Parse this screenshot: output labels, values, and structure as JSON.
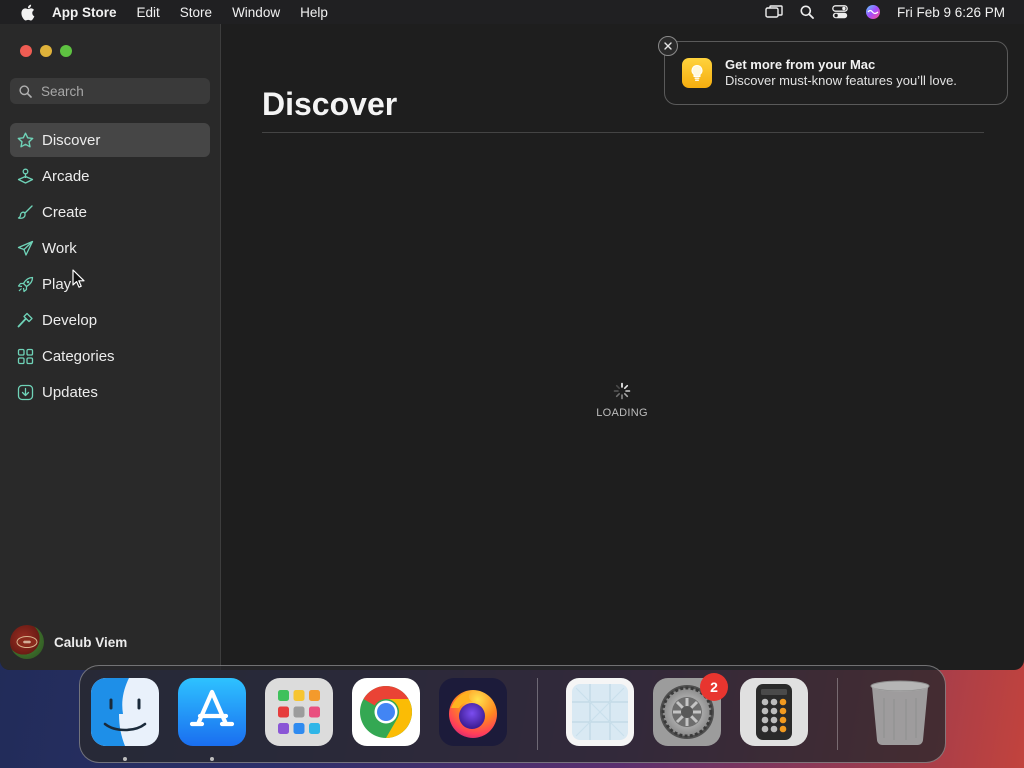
{
  "menubar": {
    "apple_icon": "apple-logo-icon",
    "app_name": "App Store",
    "items": [
      "Edit",
      "Store",
      "Window",
      "Help"
    ],
    "status_icons": [
      "screen-mirroring-icon",
      "spotlight-search-icon",
      "control-center-icon",
      "siri-icon"
    ],
    "clock": "Fri Feb 9  6:26 PM"
  },
  "sidebar": {
    "search_placeholder": "Search",
    "items": [
      {
        "label": "Discover",
        "icon": "star-icon",
        "active": true
      },
      {
        "label": "Arcade",
        "icon": "joystick-icon",
        "active": false
      },
      {
        "label": "Create",
        "icon": "paintbrush-icon",
        "active": false
      },
      {
        "label": "Work",
        "icon": "paper-plane-icon",
        "active": false
      },
      {
        "label": "Play",
        "icon": "rocket-icon",
        "active": false
      },
      {
        "label": "Develop",
        "icon": "hammer-icon",
        "active": false
      },
      {
        "label": "Categories",
        "icon": "grid-squares-icon",
        "active": false
      },
      {
        "label": "Updates",
        "icon": "download-icon",
        "active": false
      }
    ],
    "user_name": "Calub Viem"
  },
  "main": {
    "title": "Discover",
    "loading_label": "LOADING"
  },
  "notification": {
    "title": "Get more from your Mac",
    "body": "Discover must-know features you’ll love.",
    "app_icon": "tips-lightbulb-icon"
  },
  "dock": {
    "apps": [
      {
        "name": "Finder",
        "icon": "finder-icon",
        "running": true
      },
      {
        "name": "App Store",
        "icon": "app-store-icon",
        "running": true
      },
      {
        "name": "Launchpad",
        "icon": "launchpad-icon",
        "running": false
      },
      {
        "name": "Google Chrome",
        "icon": "chrome-icon",
        "running": false
      },
      {
        "name": "Firefox",
        "icon": "firefox-icon",
        "running": false
      },
      {
        "name": "Preview",
        "icon": "preview-icon",
        "running": false
      },
      {
        "name": "System Settings",
        "icon": "system-settings-icon",
        "running": false,
        "badge": "2"
      },
      {
        "name": "Calculator",
        "icon": "calculator-icon",
        "running": false
      },
      {
        "name": "Trash",
        "icon": "trash-icon",
        "running": false
      }
    ]
  },
  "colors": {
    "accent_icon": "#6fd3b8",
    "sidebar_active": "#464646",
    "badge": "#e8352f"
  }
}
